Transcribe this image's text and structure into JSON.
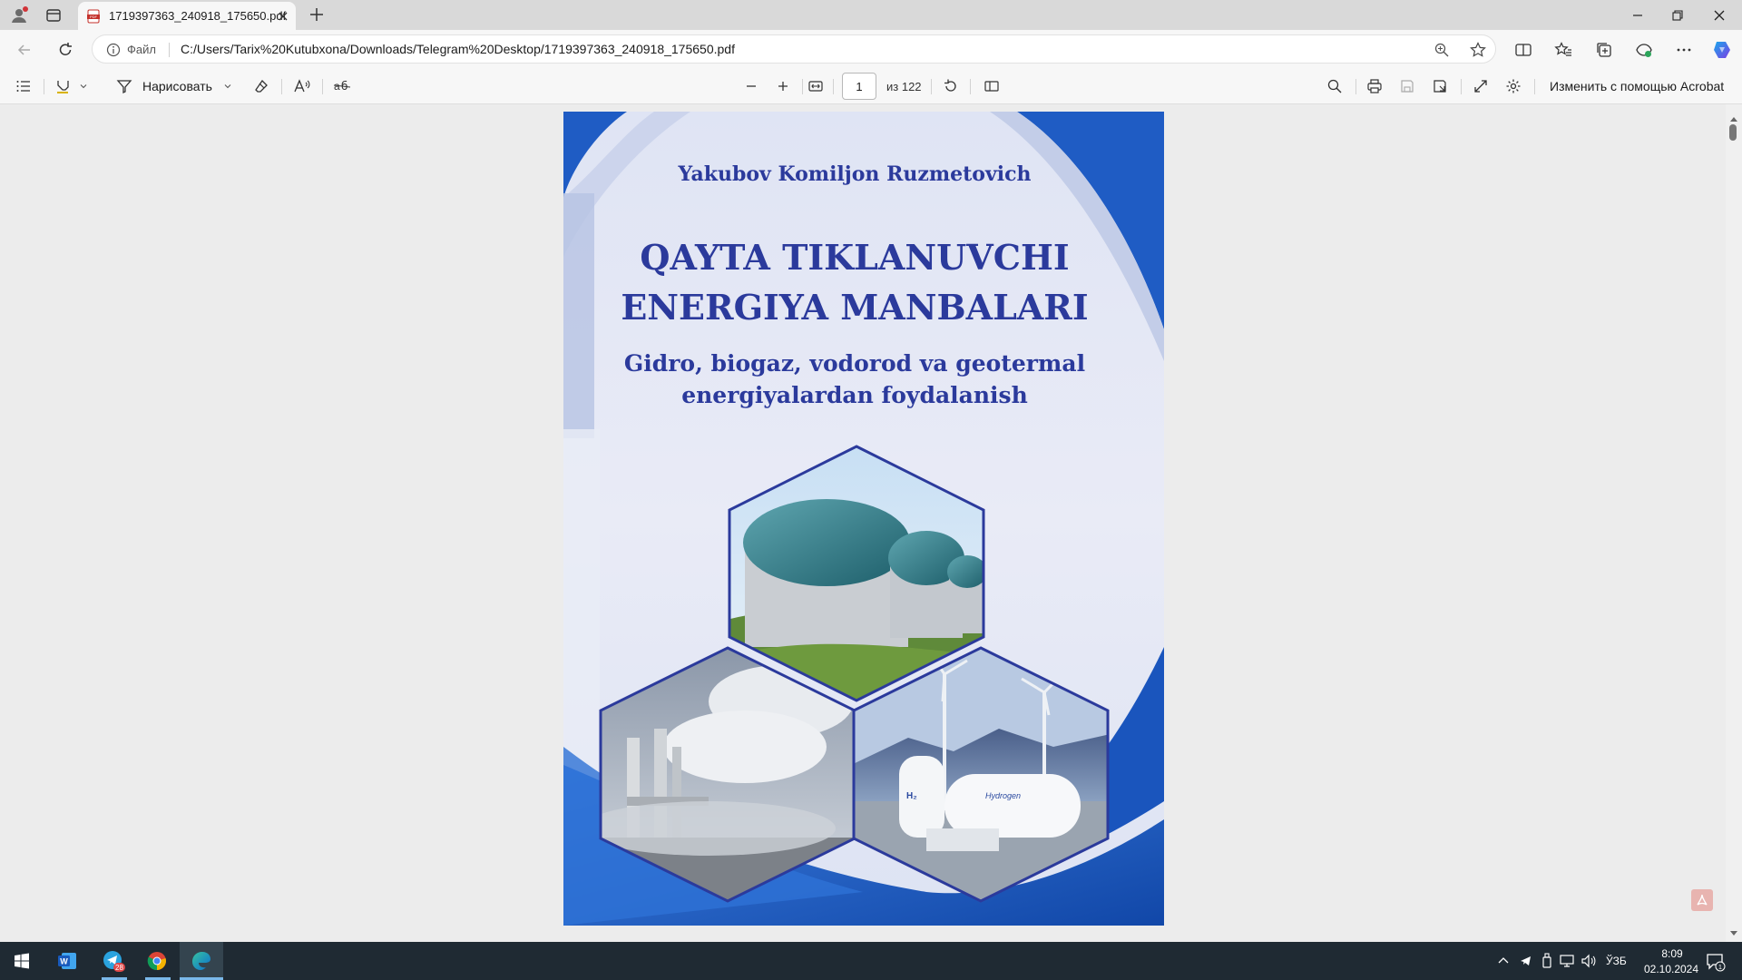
{
  "browser": {
    "tab_title": "1719397363_240918_175650.pdf",
    "address_scheme_label": "Файл",
    "address_url": "C:/Users/Tarix%20Kutubxona/Downloads/Telegram%20Desktop/1719397363_240918_175650.pdf"
  },
  "pdf_toolbar": {
    "draw_label": "Нарисовать",
    "current_page": "1",
    "page_total": "из 122",
    "acrobat_label": "Изменить с помощью Acrobat"
  },
  "cover": {
    "author": "Yakubov Komiljon Ruzmetovich",
    "title_line1": "QAYTA TIKLANUVCHI",
    "title_line2": "ENERGIYA MANBALARI",
    "subtitle_line1": "Gidro, biogaz, vodorod va geotermal",
    "subtitle_line2": "energiyalardan foydalanish",
    "tank_label": "Hydrogen",
    "tank_formula": "H₂"
  },
  "taskbar": {
    "telegram_badge": "28",
    "language": "ЎЗБ",
    "time": "8:09",
    "date": "02.10.2024",
    "notifications": "1"
  },
  "colors": {
    "accent_blue": "#2b3a9c",
    "cover_blue": "#1f5cc4",
    "taskbar_bg": "#1f2a33"
  }
}
